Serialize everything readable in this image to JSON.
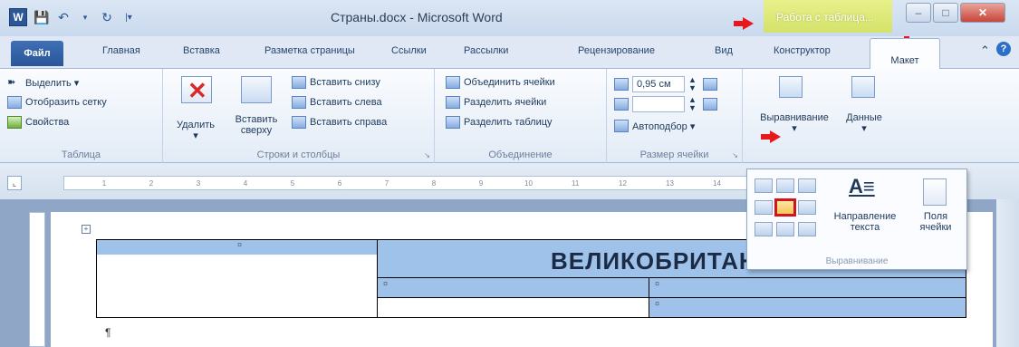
{
  "window": {
    "title": "Страны.docx - Microsoft Word",
    "context_tab": "Работа с таблица...",
    "word_icon_letter": "W"
  },
  "tabs": {
    "file": "Файл",
    "items": [
      "Главная",
      "Вставка",
      "Разметка страницы",
      "Ссылки",
      "Рассылки",
      "Рецензирование",
      "Вид",
      "Конструктор",
      "Макет"
    ]
  },
  "ribbon": {
    "table_group": {
      "label": "Таблица",
      "select": "Выделить ▾",
      "gridlines": "Отобразить сетку",
      "properties": "Свойства"
    },
    "rows_cols": {
      "label": "Строки и столбцы",
      "delete": "Удалить",
      "insert_above_1": "Вставить",
      "insert_above_2": "сверху",
      "insert_below": "Вставить снизу",
      "insert_left": "Вставить слева",
      "insert_right": "Вставить справа"
    },
    "merge": {
      "label": "Объединение",
      "merge_cells": "Объединить ячейки",
      "split_cells": "Разделить ячейки",
      "split_table": "Разделить таблицу"
    },
    "cell_size": {
      "label": "Размер ячейки",
      "height": "0,95 см",
      "width": "",
      "autofit": "Автоподбор ▾"
    },
    "alignment_btn": "Выравнивание",
    "data_btn": "Данные"
  },
  "dropdown": {
    "text_direction_1": "Направление",
    "text_direction_2": "текста",
    "cell_margins_1": "Поля",
    "cell_margins_2": "ячейки",
    "label": "Выравнивание"
  },
  "ruler": {
    "ticks": [
      "1",
      "2",
      "3",
      "4",
      "5",
      "6",
      "7",
      "8",
      "9",
      "10",
      "11",
      "12",
      "13",
      "14"
    ]
  },
  "document": {
    "heading": "ВЕЛИКОБРИТАНИЯ",
    "cell_mark": "¤",
    "pilcrow": "¶"
  }
}
